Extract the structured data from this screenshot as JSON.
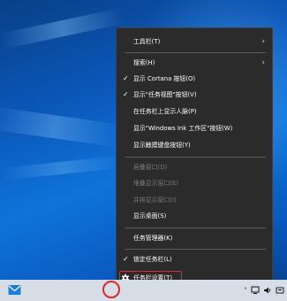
{
  "menu": {
    "items": [
      {
        "label": "工具栏(T)",
        "check": "",
        "arrow": "›"
      },
      {
        "label": "搜索(H)",
        "check": "",
        "arrow": "›"
      },
      {
        "label": "显示 Cortana 按钮(O)",
        "check": "✓",
        "arrow": ""
      },
      {
        "label": "显示\"任务视图\"按钮(V)",
        "check": "✓",
        "arrow": ""
      },
      {
        "label": "在任务栏上显示人脉(P)",
        "check": "",
        "arrow": ""
      },
      {
        "label": "显示\"Windows Ink 工作区\"按钮(W)",
        "check": "",
        "arrow": ""
      },
      {
        "label": "显示触摸键盘按钮(Y)",
        "check": "",
        "arrow": ""
      },
      {
        "label": "层叠窗口(D)",
        "check": "",
        "arrow": ""
      },
      {
        "label": "堆叠显示窗口(E)",
        "check": "",
        "arrow": ""
      },
      {
        "label": "并排显示窗口(I)",
        "check": "",
        "arrow": ""
      },
      {
        "label": "显示桌面(S)",
        "check": "",
        "arrow": ""
      },
      {
        "label": "任务管理器(K)",
        "check": "",
        "arrow": ""
      },
      {
        "label": "锁定任务栏(L)",
        "check": "✓",
        "arrow": ""
      },
      {
        "label": "任务栏设置(T)",
        "check": "",
        "arrow": ""
      }
    ]
  },
  "taskbar": {
    "tray_caret": "˄",
    "colors": {
      "highlight": "#e0282a",
      "menu_bg": "#2b2b2b",
      "taskbar_bg": "#d6dde6"
    }
  }
}
